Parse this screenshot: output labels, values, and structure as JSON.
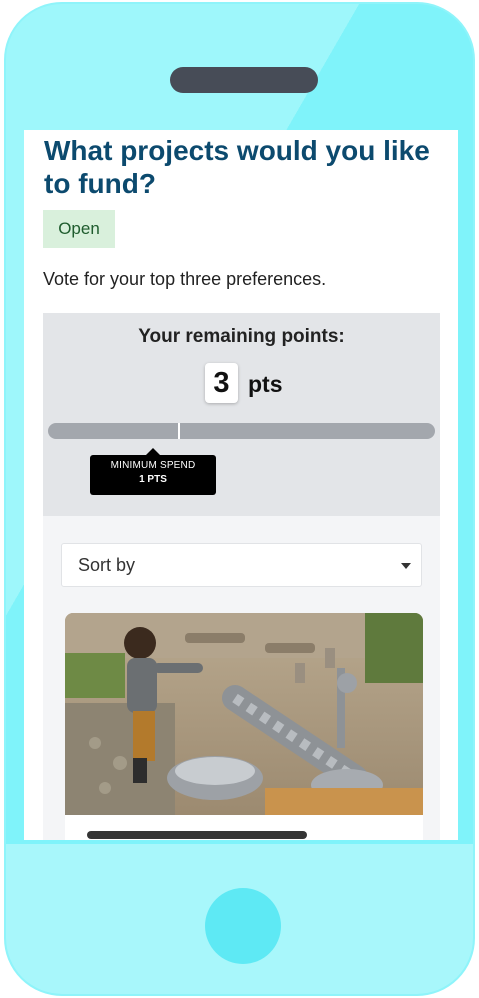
{
  "page": {
    "title": "What projects would you like to fund?",
    "status_badge": "Open",
    "instructions": "Vote for your top three preferences."
  },
  "points": {
    "label": "Your remaining points:",
    "value": "3",
    "unit": "pts",
    "minimum_spend_fraction": 0.335,
    "tooltip": {
      "line1": "MINIMUM SPEND",
      "line2": "1 PTS"
    }
  },
  "sort": {
    "label": "Sort by"
  },
  "colors": {
    "title": "#0c4a6e",
    "badge_bg": "#d9f0dc",
    "phone_body": "#7ff3fa",
    "home_button": "#5ee9f4"
  },
  "icons": {
    "sort_caret": "chevron-down-icon"
  }
}
